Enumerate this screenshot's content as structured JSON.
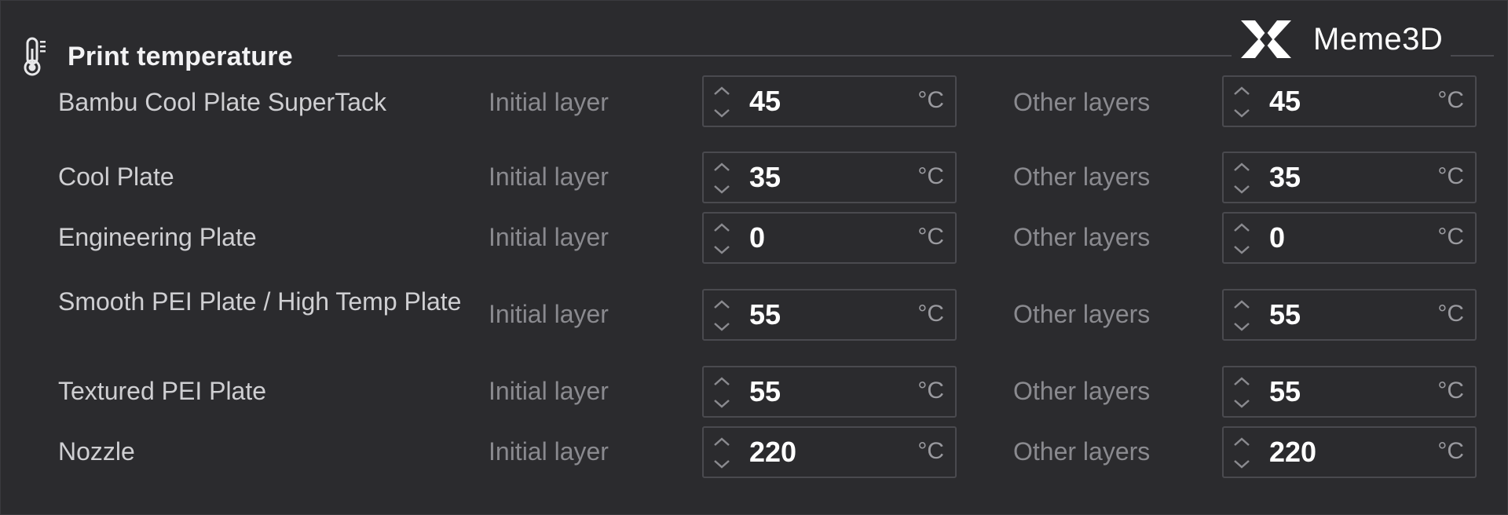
{
  "section": {
    "title": "Print temperature",
    "icon": "thermometer-icon"
  },
  "brand": {
    "name": "Meme3D"
  },
  "labels": {
    "initial_layer": "Initial layer",
    "other_layers": "Other layers",
    "unit": "°C"
  },
  "rows": [
    {
      "name": "Bambu Cool Plate SuperTack",
      "initial": "45",
      "other": "45"
    },
    {
      "name": "Cool Plate",
      "initial": "35",
      "other": "35"
    },
    {
      "name": "Engineering Plate",
      "initial": "0",
      "other": "0"
    },
    {
      "name": "Smooth PEI Plate / High Temp Plate",
      "initial": "55",
      "other": "55"
    },
    {
      "name": "Textured PEI Plate",
      "initial": "55",
      "other": "55"
    },
    {
      "name": "Nozzle",
      "initial": "220",
      "other": "220"
    }
  ]
}
